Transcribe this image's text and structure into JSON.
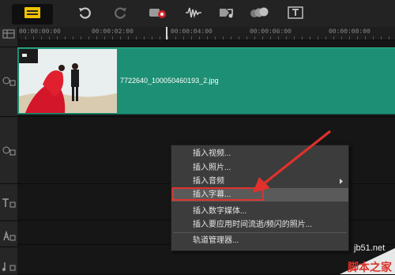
{
  "toolbar": {
    "buttons": [
      {
        "icon": "timeline-view-icon"
      },
      {
        "icon": "undo-icon"
      },
      {
        "icon": "redo-icon"
      },
      {
        "icon": "record-capture-icon"
      },
      {
        "icon": "audio-waveform-icon"
      },
      {
        "icon": "auto-music-icon"
      },
      {
        "icon": "motion-tracking-icon"
      },
      {
        "icon": "title-text-icon"
      }
    ]
  },
  "ruler": {
    "ticks": [
      "00:00:00:00",
      "00:00:02:00",
      "00:00:04:00",
      "00:00:06:00",
      "00:00:08:00"
    ]
  },
  "clip": {
    "filename": "7722640_100050460193_2.jpg"
  },
  "context_menu": {
    "items": [
      {
        "label": "插入视频..."
      },
      {
        "label": "插入照片..."
      },
      {
        "label": "插入音频",
        "submenu": true
      },
      {
        "label": "插入字幕...",
        "highlighted": true
      },
      {
        "label": "插入数字媒体..."
      },
      {
        "label": "插入要应用时间流逝/频闪的照片..."
      },
      {
        "label": "轨道管理器..."
      }
    ]
  },
  "watermark": {
    "site": "jb51.net",
    "brand": "脚本之家"
  },
  "colors": {
    "clip": "#1d8f74",
    "highlight_border": "#e0312c",
    "arrow": "#e0312c"
  }
}
